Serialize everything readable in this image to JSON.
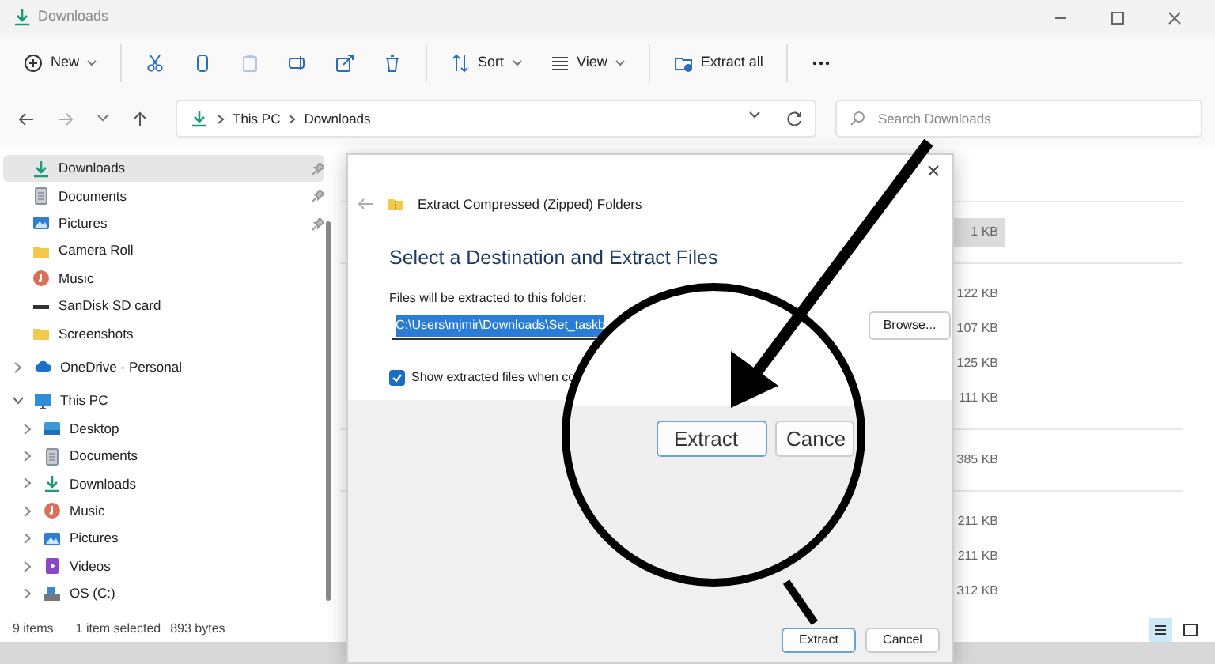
{
  "window": {
    "title": "Downloads"
  },
  "toolbar": [
    {
      "kind": "new",
      "label": "New",
      "caret": true,
      "disabled": false,
      "separator_after": true
    },
    {
      "kind": "cut",
      "disabled": false,
      "separator_after": false
    },
    {
      "kind": "copy",
      "disabled": false,
      "separator_after": false
    },
    {
      "kind": "paste",
      "disabled": true,
      "separator_after": false
    },
    {
      "kind": "rename",
      "disabled": false,
      "separator_after": false
    },
    {
      "kind": "share",
      "disabled": false,
      "separator_after": false
    },
    {
      "kind": "delete",
      "disabled": false,
      "separator_after": true
    },
    {
      "kind": "sort",
      "label": "Sort",
      "caret": true,
      "disabled": false,
      "separator_after": false
    },
    {
      "kind": "view",
      "label": "View",
      "caret": true,
      "disabled": false,
      "separator_after": true
    },
    {
      "kind": "extract",
      "label": "Extract all",
      "caret": false,
      "disabled": false,
      "separator_after": true
    },
    {
      "kind": "more",
      "disabled": false,
      "separator_after": false
    }
  ],
  "address": {
    "path": [
      "This PC",
      "Downloads"
    ]
  },
  "search": {
    "placeholder": "Search Downloads"
  },
  "sidebar": {
    "items": [
      {
        "label": "Downloads",
        "kind": "download",
        "pinned": true,
        "selected": true
      },
      {
        "label": "Documents",
        "kind": "document",
        "pinned": true,
        "selected": false
      },
      {
        "label": "Pictures",
        "kind": "picture",
        "pinned": true,
        "selected": false
      },
      {
        "label": "Camera Roll",
        "kind": "folder",
        "pinned": false,
        "selected": false
      },
      {
        "label": "Music",
        "kind": "music",
        "pinned": false,
        "selected": false
      },
      {
        "label": "SanDisk SD card",
        "kind": "drive",
        "pinned": false,
        "selected": false
      },
      {
        "label": "Screenshots",
        "kind": "folder",
        "pinned": false,
        "selected": false
      },
      {
        "label": "OneDrive - Personal",
        "kind": "cloud",
        "pinned": false,
        "selected": false,
        "expanded": false
      },
      {
        "label": "This PC",
        "kind": "pc",
        "pinned": false,
        "selected": false,
        "expanded": true,
        "children": [
          {
            "label": "Desktop",
            "kind": "desktop",
            "selected": false,
            "expanded": false
          },
          {
            "label": "Documents",
            "kind": "document",
            "selected": false,
            "expanded": false
          },
          {
            "label": "Downloads",
            "kind": "download",
            "selected": false,
            "expanded": false
          },
          {
            "label": "Music",
            "kind": "music",
            "selected": false,
            "expanded": false
          },
          {
            "label": "Pictures",
            "kind": "picture",
            "selected": false,
            "expanded": false
          },
          {
            "label": "Videos",
            "kind": "video",
            "selected": false,
            "expanded": false
          },
          {
            "label": "OS (C:)",
            "kind": "disk",
            "selected": false,
            "expanded": false
          }
        ]
      }
    ]
  },
  "files": {
    "groups": [
      [
        {
          "size": "1 KB",
          "selected": true
        }
      ],
      [
        {
          "size": "122 KB",
          "selected": false
        },
        {
          "size": "107 KB",
          "selected": false
        },
        {
          "size": "125 KB",
          "selected": false
        },
        {
          "size": "111 KB",
          "selected": false
        }
      ],
      [
        {
          "size": "385 KB",
          "selected": false
        }
      ],
      [
        {
          "size": "211 KB",
          "selected": false
        },
        {
          "size": "211 KB",
          "selected": false
        },
        {
          "size": "312 KB",
          "selected": false
        }
      ]
    ]
  },
  "status_bar": {
    "count": "9 items",
    "selection": "1 item selected",
    "size": "893 bytes"
  },
  "view_buttons": [
    {
      "kind": "details",
      "selected": true
    },
    {
      "kind": "tiles",
      "selected": false
    }
  ],
  "dialog": {
    "title": "Extract Compressed (Zipped) Folders",
    "heading": "Select a Destination and Extract Files",
    "label": "Files will be extracted to this folder:",
    "path": "C:\\Users\\mjmir\\Downloads\\Set_taskb",
    "browse": "Browse...",
    "checkbox": {
      "label": "Show extracted files when co",
      "checked": true
    },
    "buttons": [
      "Extract",
      "Cancel"
    ]
  },
  "magnifier": {
    "buttons": [
      "Extract",
      "Cance"
    ]
  }
}
